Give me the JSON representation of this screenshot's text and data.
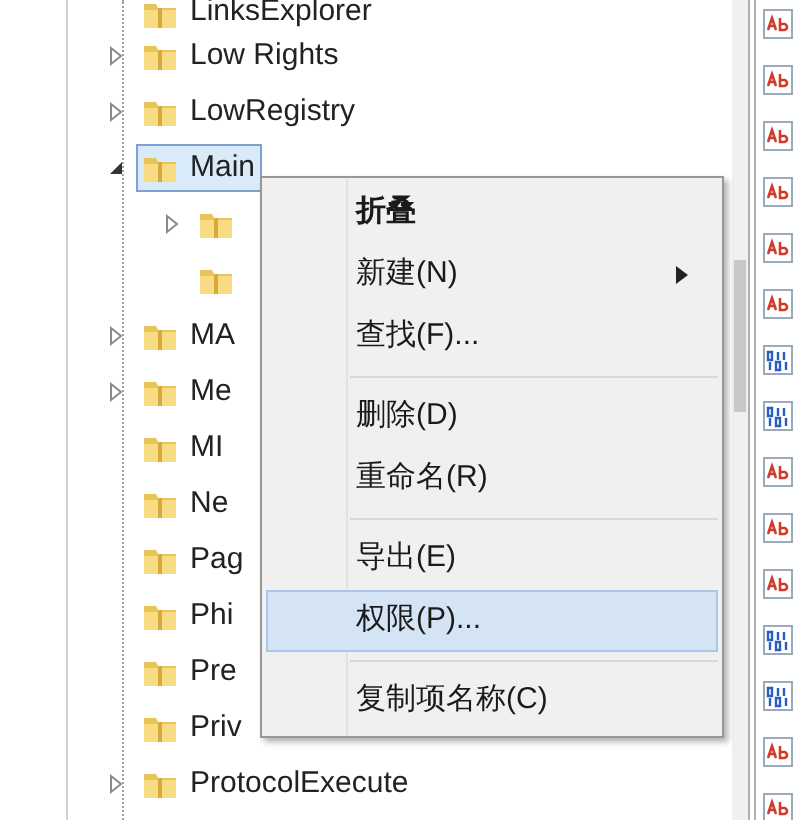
{
  "tree": [
    {
      "name": "LinksExplorer",
      "selected": false
    },
    {
      "name": "Low Rights",
      "expanded": false,
      "selected": false
    },
    {
      "name": "LowRegistry",
      "expanded": false,
      "selected": false
    },
    {
      "name": "Main",
      "expanded": true,
      "selected": true,
      "children": [
        {
          "expanded": false,
          "selected": false
        },
        {
          "selected": false
        }
      ]
    },
    {
      "name": "MA",
      "expanded": false,
      "selected": false
    },
    {
      "name": "Me",
      "expanded": false,
      "selected": false
    },
    {
      "name": "MI",
      "selected": false
    },
    {
      "name": "Ne",
      "selected": false
    },
    {
      "name": "Pag",
      "selected": false
    },
    {
      "name": "Phi",
      "selected": false
    },
    {
      "name": "Pre",
      "selected": false
    },
    {
      "name": "Priv",
      "selected": false
    },
    {
      "name": "ProtocolExecute",
      "expanded": false,
      "selected": false
    }
  ],
  "value_icons": [
    {
      "kind": "string"
    },
    {
      "kind": "string"
    },
    {
      "kind": "string"
    },
    {
      "kind": "string"
    },
    {
      "kind": "string"
    },
    {
      "kind": "string"
    },
    {
      "kind": "binary"
    },
    {
      "kind": "binary"
    },
    {
      "kind": "string"
    },
    {
      "kind": "string"
    },
    {
      "kind": "string"
    },
    {
      "kind": "binary"
    },
    {
      "kind": "binary"
    },
    {
      "kind": "string"
    },
    {
      "kind": "string"
    }
  ],
  "context_menu": [
    {
      "kind": "item",
      "label": "折叠",
      "bold": true,
      "submenu": false,
      "selected": false
    },
    {
      "kind": "item",
      "label": "新建(N)",
      "bold": false,
      "submenu": true,
      "selected": false
    },
    {
      "kind": "item",
      "label": "查找(F)...",
      "bold": false,
      "submenu": false,
      "selected": false
    },
    {
      "kind": "separator"
    },
    {
      "kind": "item",
      "label": "删除(D)",
      "bold": false,
      "submenu": false,
      "selected": false
    },
    {
      "kind": "item",
      "label": "重命名(R)",
      "bold": false,
      "submenu": false,
      "selected": false
    },
    {
      "kind": "separator"
    },
    {
      "kind": "item",
      "label": "导出(E)",
      "bold": false,
      "submenu": false,
      "selected": false
    },
    {
      "kind": "item",
      "label": "权限(P)...",
      "bold": false,
      "submenu": false,
      "selected": true
    },
    {
      "kind": "separator"
    },
    {
      "kind": "item",
      "label": "复制项名称(C)",
      "bold": false,
      "submenu": false,
      "selected": false
    }
  ]
}
